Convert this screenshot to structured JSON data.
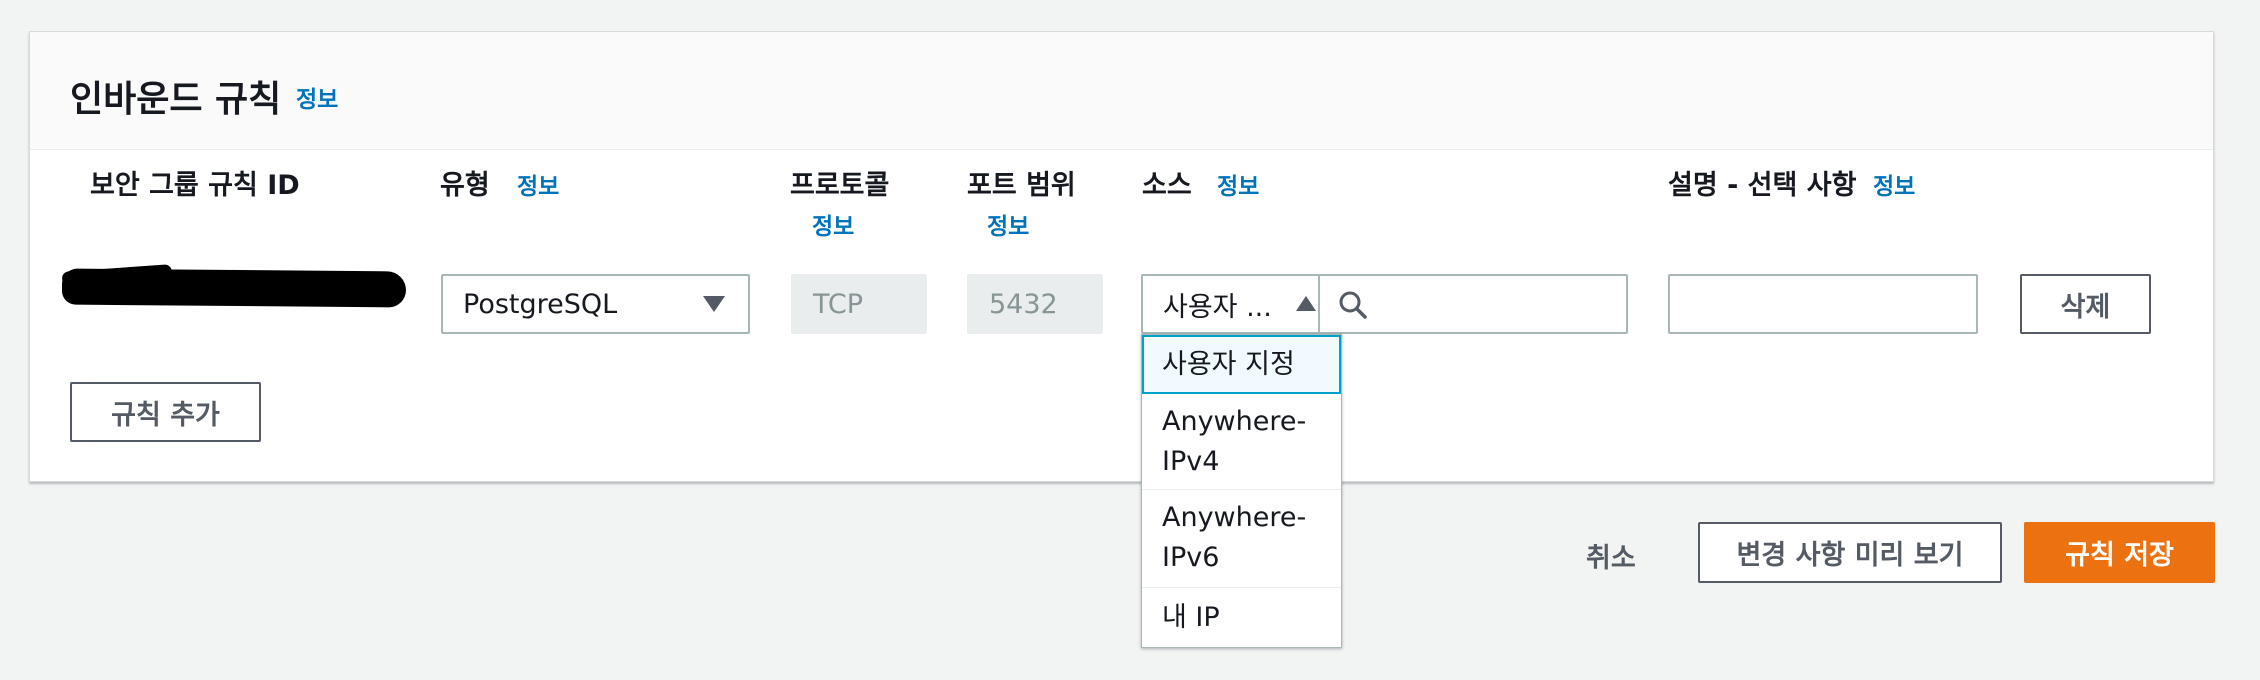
{
  "panel": {
    "title": "인바운드 규칙",
    "info_link": "정보"
  },
  "columns": {
    "rule_id": "보안 그룹 규칙 ID",
    "type": "유형",
    "type_info": "정보",
    "protocol": "프로토콜",
    "protocol_info": "정보",
    "port_range": "포트 범위",
    "port_range_info": "정보",
    "source": "소스",
    "source_info": "정보",
    "description": "설명 - 선택 사항",
    "description_info": "정보"
  },
  "rule": {
    "type_value": "PostgreSQL",
    "protocol_value": "TCP",
    "port_value": "5432",
    "source_value": "사용자 ...",
    "source_search_value": "",
    "description_value": "",
    "delete_label": "삭제"
  },
  "source_options": [
    {
      "label": "사용자 지정",
      "selected": true
    },
    {
      "label": "Anywhere-\nIPv4",
      "selected": false
    },
    {
      "label": "Anywhere-\nIPv6",
      "selected": false
    },
    {
      "label": "내 IP",
      "selected": false
    }
  ],
  "add_rule_label": "규칙 추가",
  "footer": {
    "cancel_label": "취소",
    "preview_label": "변경 사항 미리 보기",
    "save_label": "규칙 저장"
  },
  "colors": {
    "link": "#0073bb",
    "primary": "#ec7211",
    "selected_border": "#00a1c9"
  }
}
